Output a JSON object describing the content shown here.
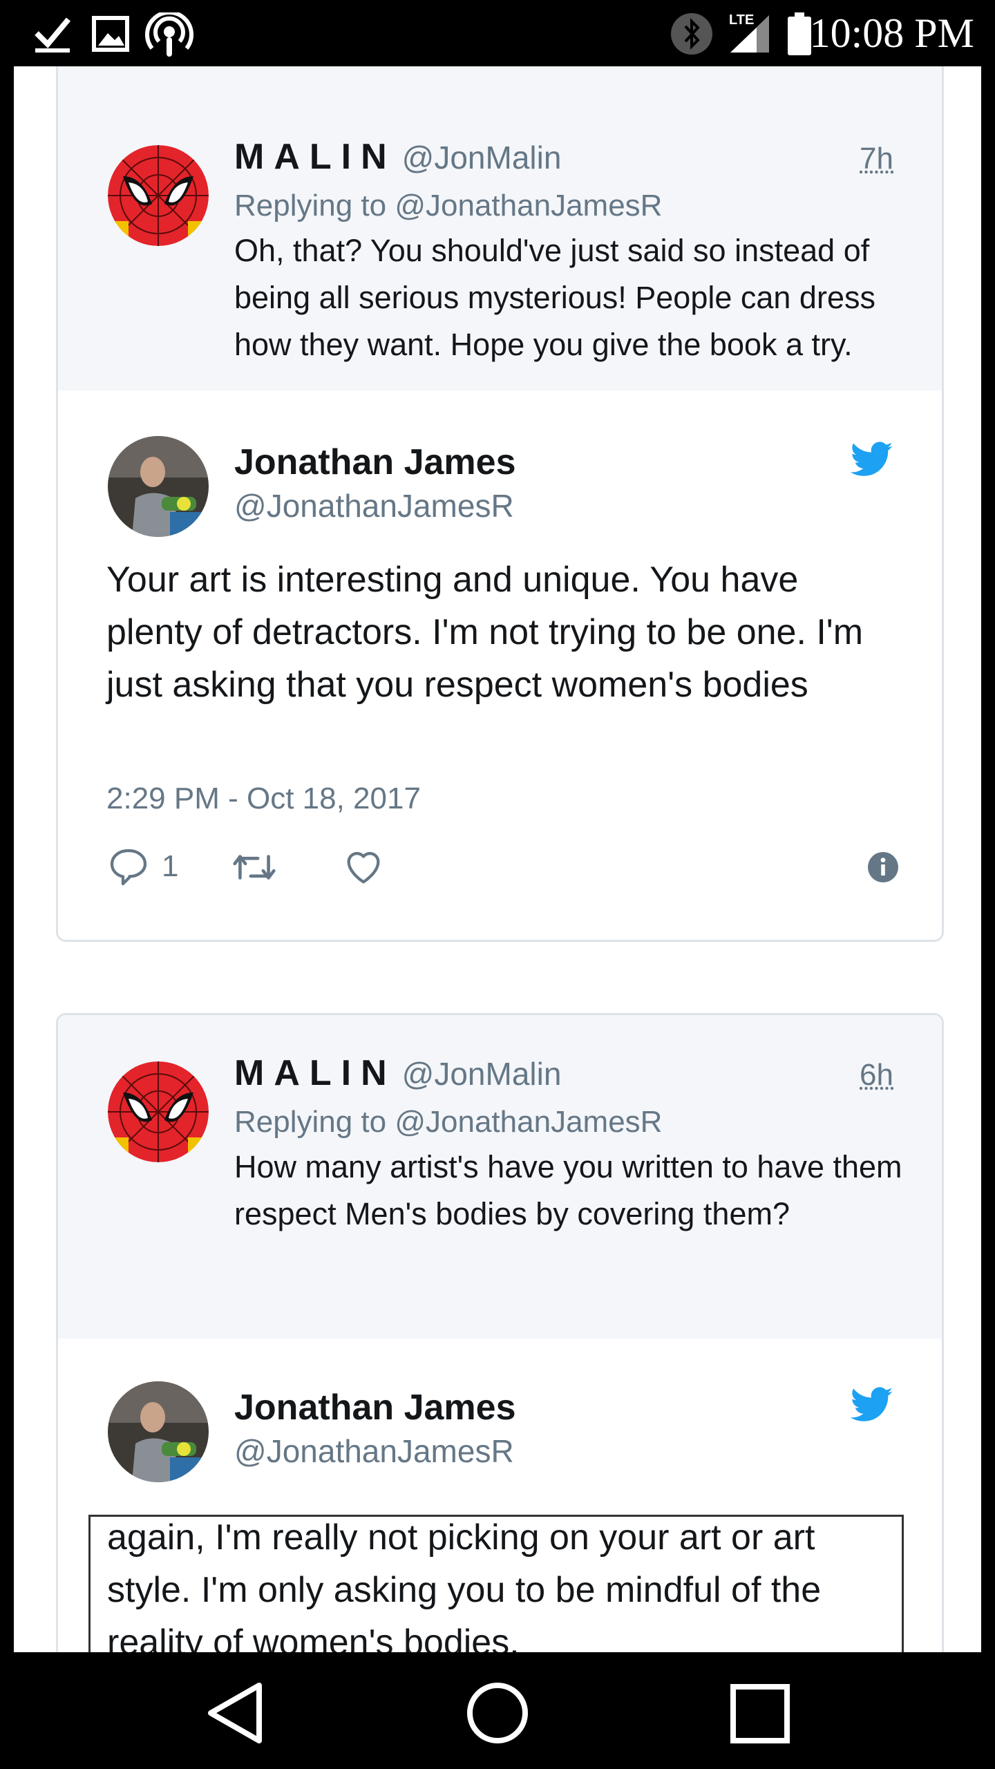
{
  "status_bar": {
    "time": "10:08 PM",
    "network": "LTE",
    "icons": [
      "checkmark-icon",
      "image-icon",
      "podcast-icon",
      "bluetooth-icon",
      "signal-icon",
      "battery-icon"
    ]
  },
  "thread1": {
    "quote": {
      "display_name": "MALIN",
      "handle": "@JonMalin",
      "time": "7h",
      "replying_to": "Replying to @JonathanJamesR",
      "text": "Oh, that? You should've just said so instead of being all serious mysterious! People can dress how they want. Hope you give the book a try."
    },
    "tweet": {
      "display_name": "Jonathan James",
      "handle": "@JonathanJamesR",
      "text": "Your art is interesting and unique. You have plenty of detractors. I'm not trying to be one. I'm just asking that you respect women's bodies",
      "timestamp": "2:29 PM - Oct 18, 2017",
      "reply_count": "1"
    }
  },
  "thread2": {
    "quote": {
      "display_name": "MALIN",
      "handle": "@JonMalin",
      "time": "6h",
      "replying_to": "Replying to @JonathanJamesR",
      "text": "How many artist's have you written to have them respect Men's bodies by covering them?"
    },
    "tweet": {
      "display_name": "Jonathan James",
      "handle": "@JonathanJamesR",
      "text_line1": "again, I'm really not picking on your art or art",
      "text_line2": "style. I'm only asking you to be mindful of the",
      "text_line3": "reality of women's bodies."
    }
  },
  "colors": {
    "twitter_blue": "#1da1f2",
    "text_primary": "#14171a",
    "text_secondary": "#657786",
    "quote_bg": "#f4f6f9"
  }
}
